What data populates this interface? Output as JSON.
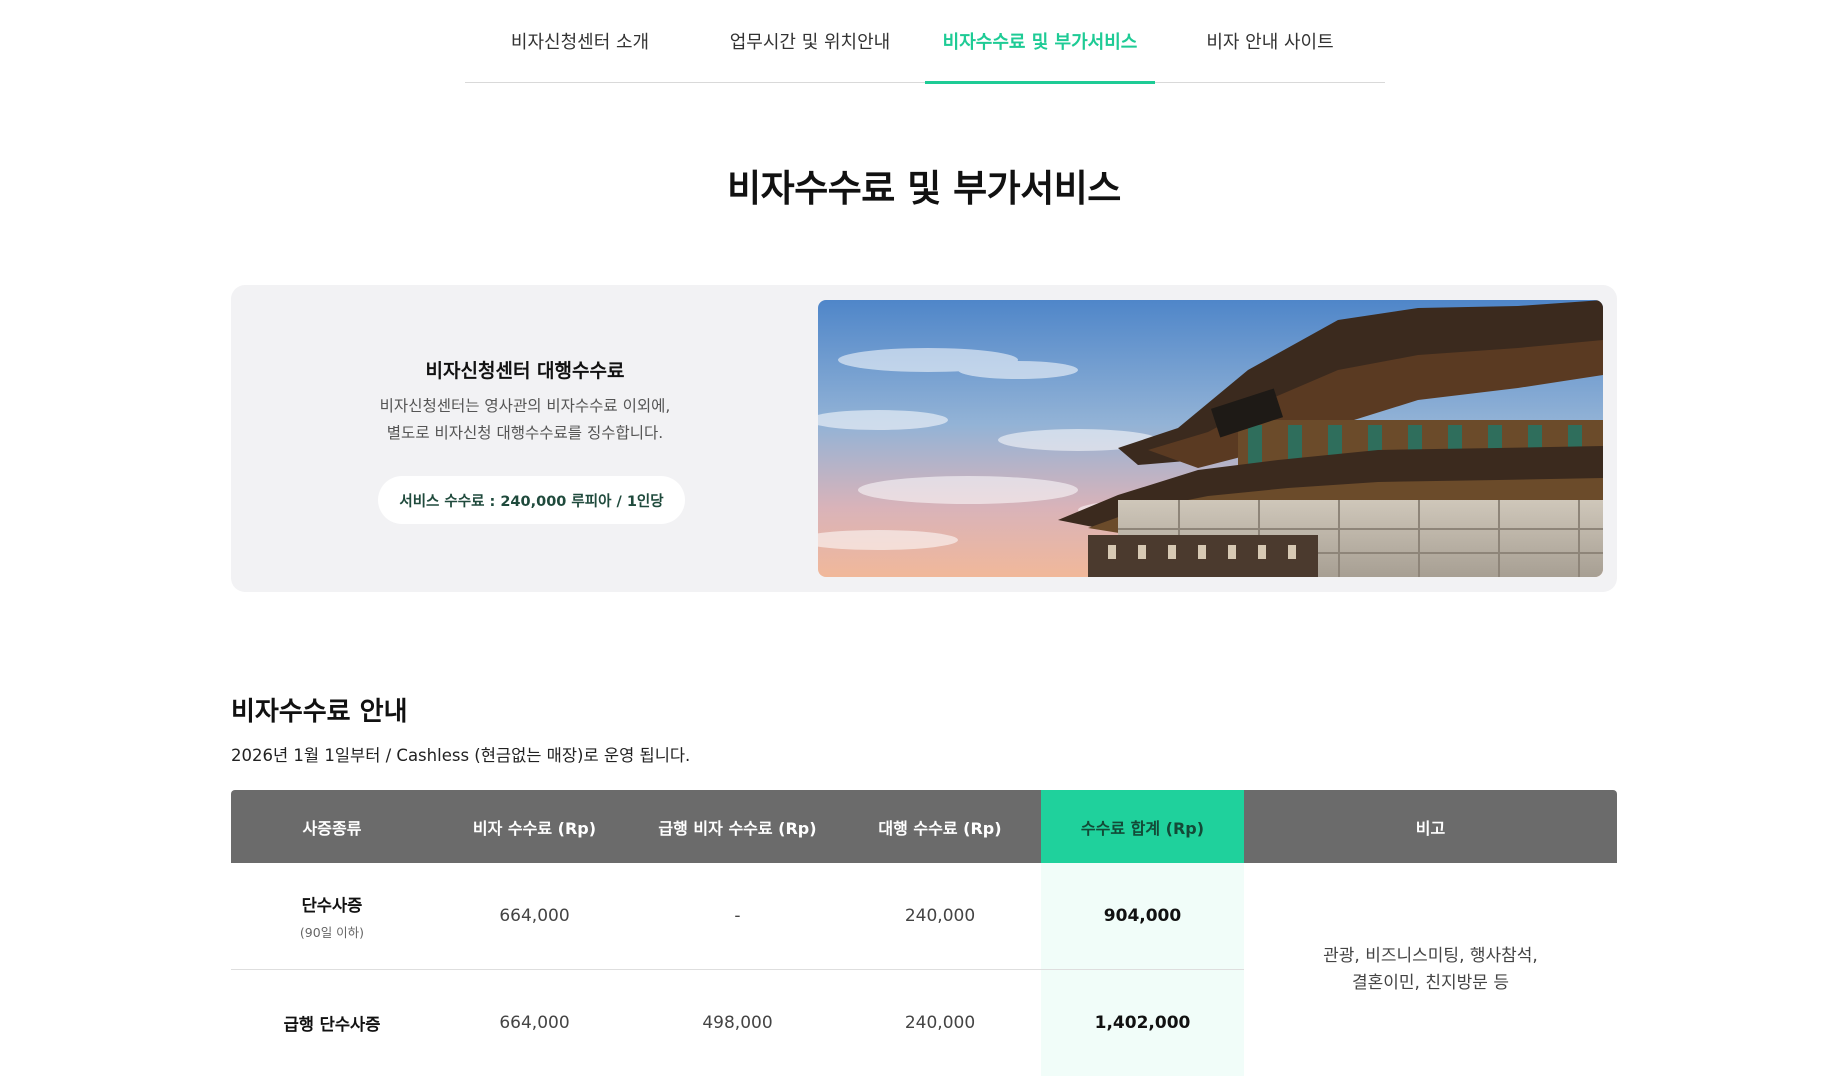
{
  "tabs": [
    {
      "label": "비자신청센터 소개",
      "active": false
    },
    {
      "label": "업무시간 및 위치안내",
      "active": false
    },
    {
      "label": "비자수수료 및 부가서비스",
      "active": true
    },
    {
      "label": "비자 안내 사이트",
      "active": false
    }
  ],
  "page": {
    "title": "비자수수료 및 부가서비스"
  },
  "hero": {
    "title": "비자신청센터 대행수수료",
    "desc_line1": "비자신청센터는 영사관의 비자수수료 이외에,",
    "desc_line2": "별도로 비자신청 대행수수료를 징수합니다.",
    "pill": "서비스 수수료 : 240,000 루피아 / 1인당"
  },
  "fees": {
    "title": "비자수수료 안내",
    "note": "2026년 1월 1일부터 / Cashless (현금없는 매장)로 운영 됩니다.",
    "headers": {
      "type": "사증종류",
      "visa_fee": "비자 수수료 (Rp)",
      "express_fee": "급행 비자 수수료 (Rp)",
      "agency_fee": "대행 수수료 (Rp)",
      "total": "수수료 합계 (Rp)",
      "remark": "비고"
    },
    "rows": [
      {
        "name": "단수사증",
        "sub": "(90일 이하)",
        "visa_fee": "664,000",
        "express_fee": "-",
        "agency_fee": "240,000",
        "total": "904,000"
      },
      {
        "name": "급행 단수사증",
        "sub": "",
        "visa_fee": "664,000",
        "express_fee": "498,000",
        "agency_fee": "240,000",
        "total": "1,402,000"
      }
    ],
    "remark_line1": "관광, 비즈니스미팅, 행사참석,",
    "remark_line2": "결혼이민, 친지방문 등"
  },
  "colors": {
    "accent": "#1ecb95",
    "header_bg": "#6b6b6b",
    "total_header_bg": "#1fd19c",
    "total_cell_bg": "#f1fdf9",
    "hero_bg": "#f2f2f4"
  }
}
